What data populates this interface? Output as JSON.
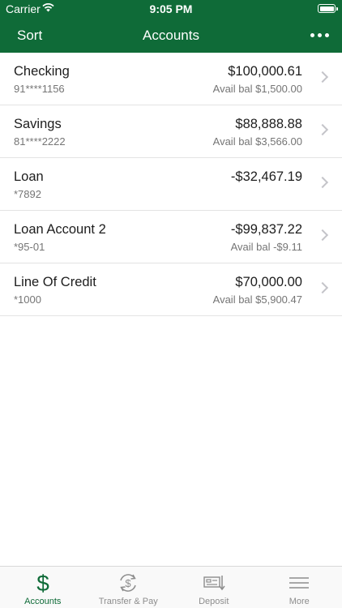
{
  "status": {
    "carrier": "Carrier",
    "time": "9:05 PM"
  },
  "nav": {
    "sort_label": "Sort",
    "title": "Accounts"
  },
  "accounts": [
    {
      "name": "Checking",
      "number": "91****1156",
      "balance": "$100,000.61",
      "available": "Avail bal $1,500.00"
    },
    {
      "name": "Savings",
      "number": "81****2222",
      "balance": "$88,888.88",
      "available": "Avail bal $3,566.00"
    },
    {
      "name": "Loan",
      "number": "*7892",
      "balance": "-$32,467.19",
      "available": ""
    },
    {
      "name": "Loan Account 2",
      "number": "*95-01",
      "balance": "-$99,837.22",
      "available": "Avail bal -$9.11"
    },
    {
      "name": "Line Of Credit",
      "number": "*1000",
      "balance": "$70,000.00",
      "available": "Avail bal $5,900.47"
    }
  ],
  "tabs": [
    {
      "label": "Accounts",
      "icon": "dollar-icon"
    },
    {
      "label": "Transfer & Pay",
      "icon": "transfer-pay-icon"
    },
    {
      "label": "Deposit",
      "icon": "deposit-check-icon"
    },
    {
      "label": "More",
      "icon": "menu-icon"
    }
  ],
  "colors": {
    "brand": "#0f6b38",
    "text_secondary": "#757575",
    "chevron": "#c4c4c9"
  }
}
